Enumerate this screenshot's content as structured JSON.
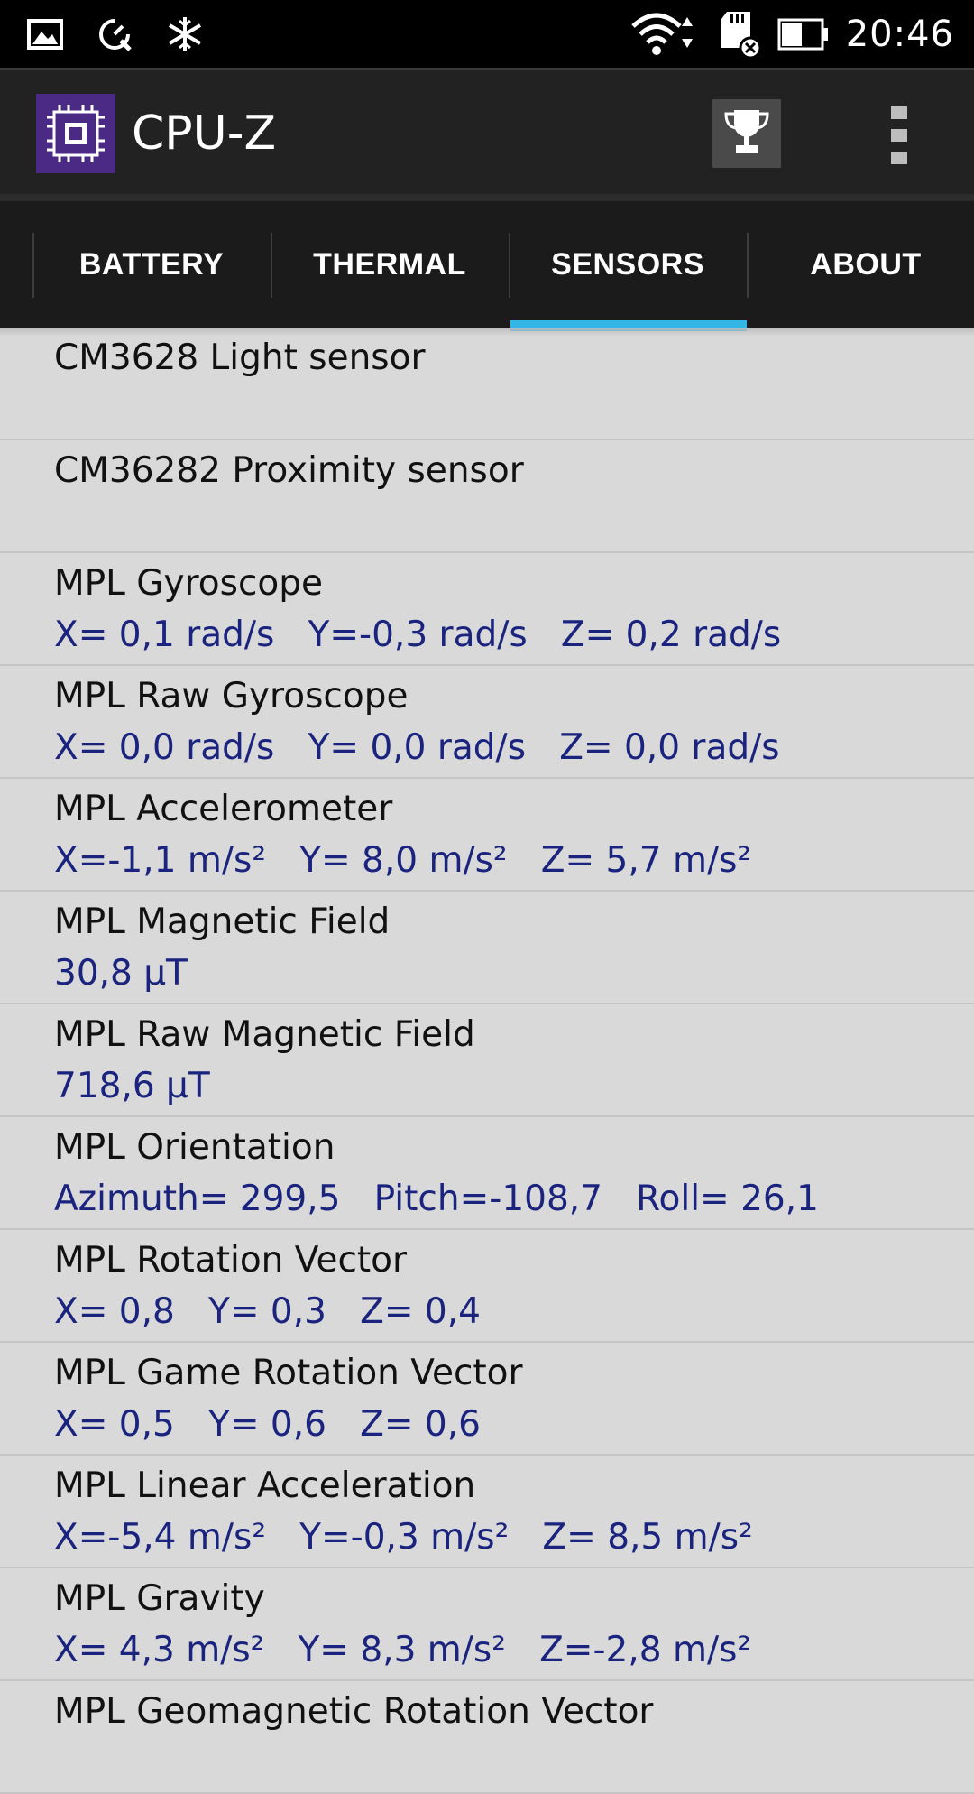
{
  "status_bar": {
    "time": "20:46",
    "left_icons": [
      "gallery-icon",
      "speed-wrench-icon",
      "snowflake-icon"
    ],
    "right_icons": [
      "wifi-icon",
      "sd-card-error-icon",
      "battery-icon"
    ]
  },
  "app_bar": {
    "title": "CPU-Z",
    "logo_icon": "cpu-chip-icon",
    "trophy_icon": "trophy-icon",
    "overflow_icon": "overflow-menu-icon"
  },
  "tabs": [
    {
      "label": "BATTERY",
      "selected": false
    },
    {
      "label": "THERMAL",
      "selected": false
    },
    {
      "label": "SENSORS",
      "selected": true
    },
    {
      "label": "ABOUT",
      "selected": false
    }
  ],
  "colors": {
    "accent": "#33b5e5",
    "value_text": "#1a237e",
    "list_bg": "#d9d9d9"
  },
  "sensors": [
    {
      "name": "CM3628 Light sensor",
      "value": ""
    },
    {
      "name": "CM36282 Proximity sensor",
      "value": ""
    },
    {
      "name": "MPL Gyroscope",
      "value": "X= 0,1 rad/s   Y=-0,3 rad/s   Z= 0,2 rad/s"
    },
    {
      "name": "MPL Raw Gyroscope",
      "value": "X= 0,0 rad/s   Y= 0,0 rad/s   Z= 0,0 rad/s"
    },
    {
      "name": "MPL Accelerometer",
      "value": "X=-1,1 m/s²   Y= 8,0 m/s²   Z= 5,7 m/s²"
    },
    {
      "name": "MPL Magnetic Field",
      "value": "30,8 µT"
    },
    {
      "name": "MPL Raw Magnetic Field",
      "value": "718,6 µT"
    },
    {
      "name": "MPL Orientation",
      "value": "Azimuth= 299,5   Pitch=-108,7   Roll= 26,1"
    },
    {
      "name": "MPL Rotation Vector",
      "value": "X= 0,8   Y= 0,3   Z= 0,4"
    },
    {
      "name": "MPL Game Rotation Vector",
      "value": "X= 0,5   Y= 0,6   Z= 0,6"
    },
    {
      "name": "MPL Linear Acceleration",
      "value": "X=-5,4 m/s²   Y=-0,3 m/s²   Z= 8,5 m/s²"
    },
    {
      "name": "MPL Gravity",
      "value": "X= 4,3 m/s²   Y= 8,3 m/s²   Z=-2,8 m/s²"
    },
    {
      "name": "MPL Geomagnetic Rotation Vector",
      "value": ""
    }
  ]
}
